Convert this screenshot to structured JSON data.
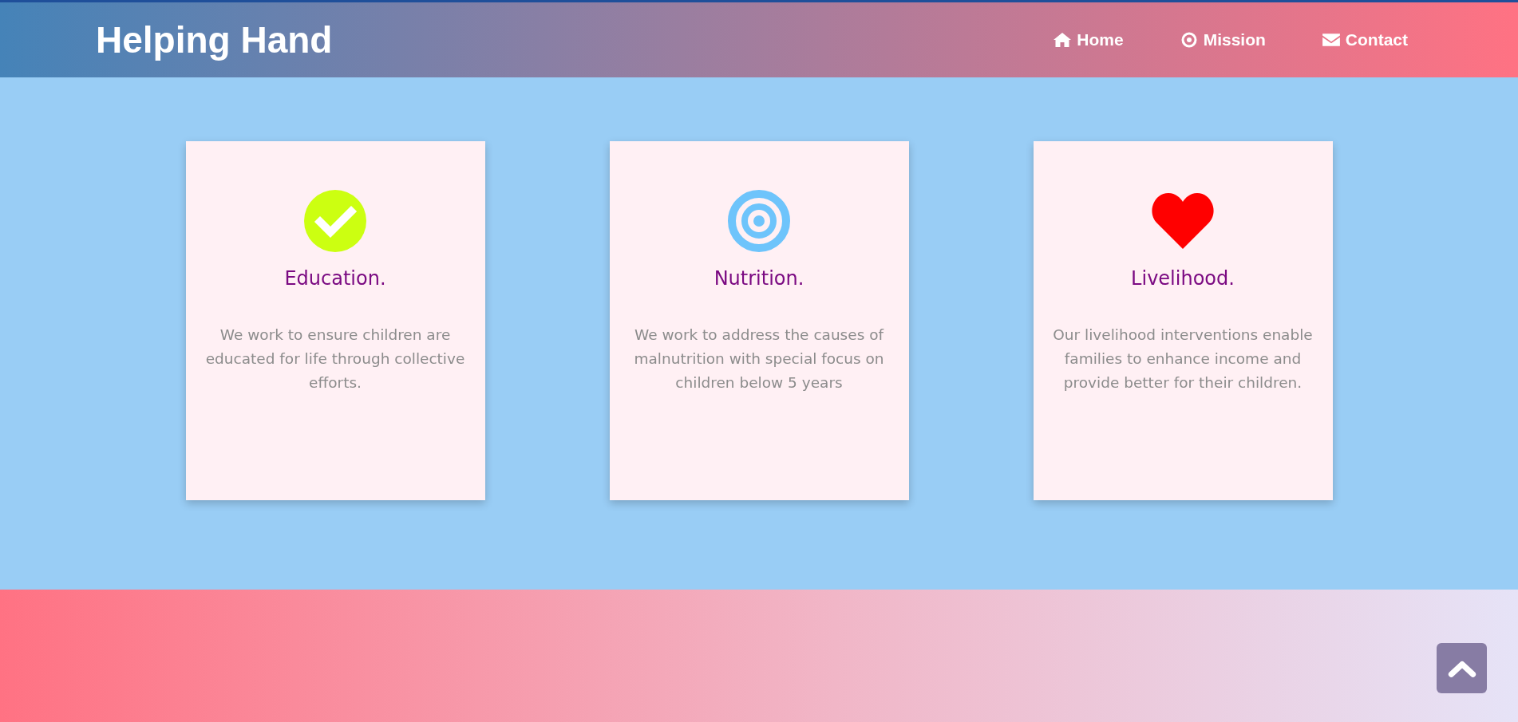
{
  "header": {
    "logo": "Helping Hand",
    "nav": [
      {
        "kind": "home",
        "label": "Home"
      },
      {
        "kind": "target",
        "label": "Mission"
      },
      {
        "kind": "mail",
        "label": "Contact"
      }
    ]
  },
  "cards": [
    {
      "kind": "check",
      "title": "Education.",
      "text": "We work to ensure children are educated for life through collective efforts."
    },
    {
      "kind": "target",
      "title": "Nutrition.",
      "text": "We work to address the causes of malnutrition with special focus on children below 5 years"
    },
    {
      "kind": "heart",
      "title": "Livelihood.",
      "text": "Our livelihood interventions enable families to enhance income and provide better for their children."
    }
  ]
}
